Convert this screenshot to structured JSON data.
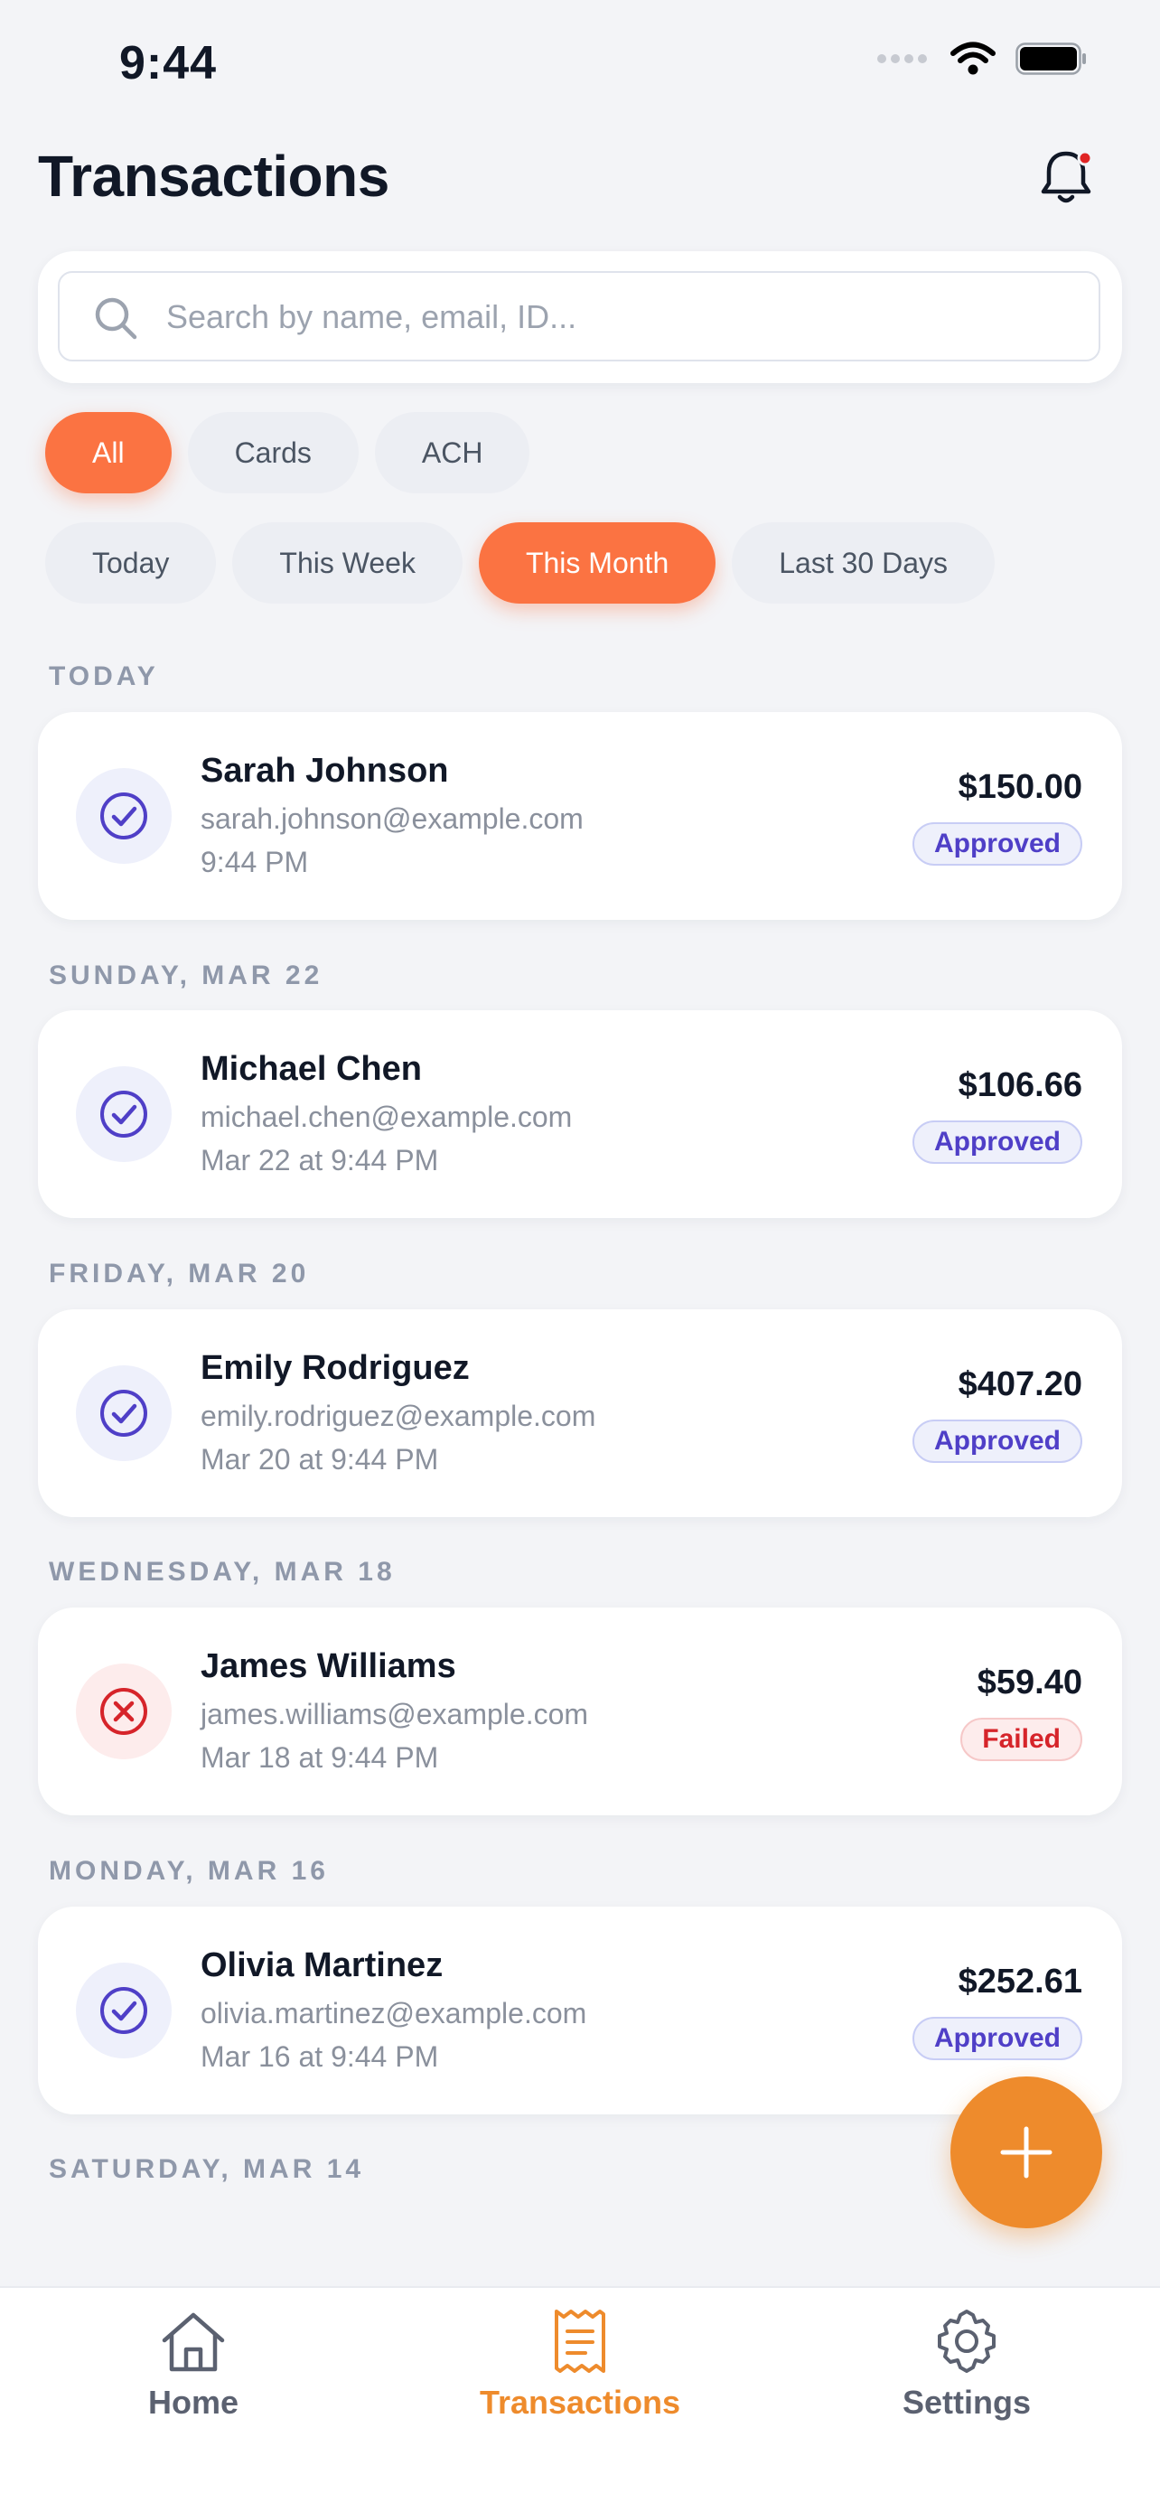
{
  "status_bar": {
    "time": "9:44"
  },
  "header": {
    "title": "Transactions"
  },
  "search": {
    "placeholder": "Search by name, email, ID..."
  },
  "type_filters": [
    {
      "label": "All",
      "active": true
    },
    {
      "label": "Cards",
      "active": false
    },
    {
      "label": "ACH",
      "active": false
    }
  ],
  "period_filters": [
    {
      "label": "Today",
      "active": false
    },
    {
      "label": "This Week",
      "active": false
    },
    {
      "label": "This Month",
      "active": true
    },
    {
      "label": "Last 30 Days",
      "active": false
    }
  ],
  "sections": [
    {
      "label": "TODAY",
      "transaction": {
        "name": "Sarah Johnson",
        "email": "sarah.johnson@example.com",
        "time": "9:44 PM",
        "amount": "$150.00",
        "status": "Approved"
      }
    },
    {
      "label": "SUNDAY, MAR 22",
      "transaction": {
        "name": "Michael Chen",
        "email": "michael.chen@example.com",
        "time": "Mar 22 at 9:44 PM",
        "amount": "$106.66",
        "status": "Approved"
      }
    },
    {
      "label": "FRIDAY, MAR 20",
      "transaction": {
        "name": "Emily Rodriguez",
        "email": "emily.rodriguez@example.com",
        "time": "Mar 20 at 9:44 PM",
        "amount": "$407.20",
        "status": "Approved"
      }
    },
    {
      "label": "WEDNESDAY, MAR 18",
      "transaction": {
        "name": "James Williams",
        "email": "james.williams@example.com",
        "time": "Mar 18 at 9:44 PM",
        "amount": "$59.40",
        "status": "Failed"
      }
    },
    {
      "label": "MONDAY, MAR 16",
      "transaction": {
        "name": "Olivia Martinez",
        "email": "olivia.martinez@example.com",
        "time": "Mar 16 at 9:44 PM",
        "amount": "$252.61",
        "status": "Approved"
      }
    },
    {
      "label": "SATURDAY, MAR 14"
    }
  ],
  "tab_bar": {
    "items": [
      {
        "label": "Home",
        "icon": "home-icon",
        "active": false
      },
      {
        "label": "Transactions",
        "icon": "receipt-icon",
        "active": true
      },
      {
        "label": "Settings",
        "icon": "gear-icon",
        "active": false
      }
    ]
  },
  "colors": {
    "accent": "#fb7342",
    "fab": "#ee8b2c",
    "approved": "#4f3fc7",
    "failed": "#d6242a",
    "background": "#f3f4f7"
  }
}
